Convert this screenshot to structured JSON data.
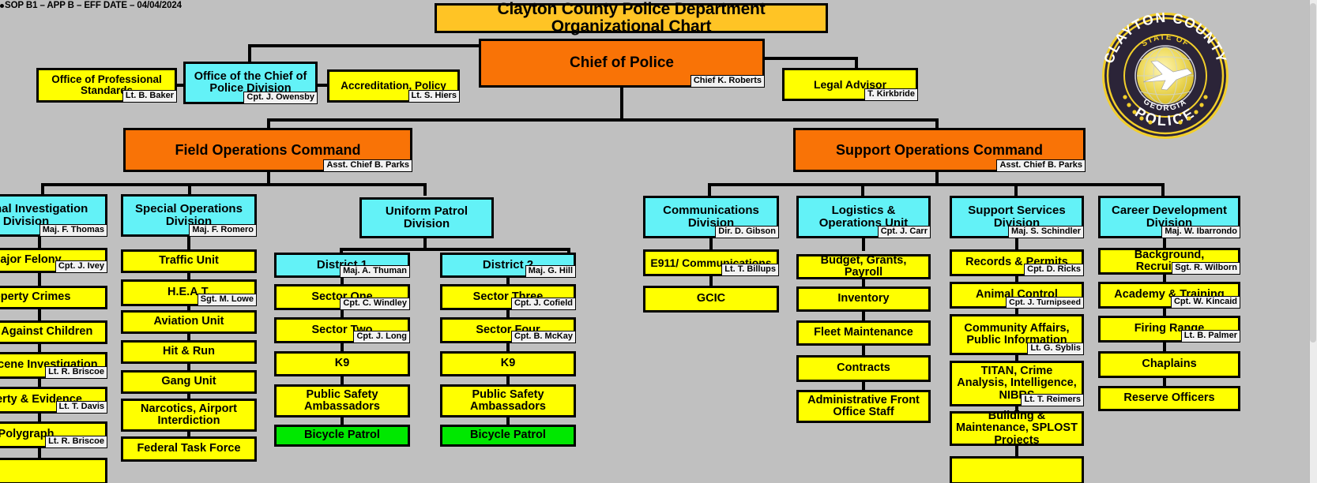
{
  "header": {
    "sop_note": "SOP B1 – APP B – EFF DATE – 04/04/2024",
    "title": "Clayton County Police Department Organizational Chart"
  },
  "seal": {
    "name": "clayton-county-police-seal",
    "outer_top_text": "CLAYTON COUNTY",
    "outer_bottom_text": "POLICE",
    "inner_top_text": "STATE OF",
    "inner_bottom_text": "GEORGIA",
    "colors": {
      "ring": "#2b2438",
      "gold": "#f2cf2b",
      "globe": "#efe06a"
    }
  },
  "colors": {
    "command": "#f97306",
    "division": "#63f2f7",
    "unit": "#ffff00",
    "highlight": "#00e800",
    "title": "#ffc425",
    "background": "#c0c0c0",
    "tag": "#f2f2f2"
  },
  "chief": {
    "label": "Chief of Police",
    "person": "Chief K. Roberts"
  },
  "chief_staff": [
    {
      "label": "Office of Professional Standards",
      "person": "Lt. B. Baker",
      "color": "unit"
    },
    {
      "label": "Office of the Chief of Police Division",
      "person": "Cpt. J. Owensby",
      "color": "division"
    },
    {
      "label": "Accreditation, Policy",
      "person": "Lt.  S. Hiers",
      "color": "unit"
    },
    {
      "label": "Legal Advisor",
      "person": "T. Kirkbride",
      "color": "unit"
    }
  ],
  "commands": [
    {
      "label": "Field Operations Command",
      "person": "Asst. Chief B. Parks"
    },
    {
      "label": "Support Operations  Command",
      "person": "Asst. Chief B. Parks"
    }
  ],
  "field_operations": {
    "divisions": [
      {
        "label": "Criminal Investigation Division",
        "person": "Maj. F. Thomas",
        "units": [
          {
            "label": "Major Felony",
            "person": "Cpt. J. Ivey"
          },
          {
            "label": "Property Crimes",
            "person": ""
          },
          {
            "label": "Crimes Against Children",
            "person": ""
          },
          {
            "label": "Crime Scene Investigation",
            "person": "Lt. R. Briscoe"
          },
          {
            "label": "Property & Evidence",
            "person": "Lt. T. Davis"
          },
          {
            "label": "Polygraph",
            "person": "Lt. R. Briscoe"
          }
        ]
      },
      {
        "label": "Special Operations Division",
        "person": "Maj. F. Romero",
        "units": [
          {
            "label": "Traffic Unit",
            "person": ""
          },
          {
            "label": "H.E.A.T.",
            "person": "Sgt. M. Lowe"
          },
          {
            "label": "Aviation Unit",
            "person": ""
          },
          {
            "label": "Hit & Run",
            "person": ""
          },
          {
            "label": "Gang Unit",
            "person": ""
          },
          {
            "label": "Narcotics, Airport Interdiction",
            "person": ""
          },
          {
            "label": "Federal Task Force",
            "person": ""
          }
        ]
      },
      {
        "label": "Uniform Patrol Division",
        "person": "",
        "districts": [
          {
            "label": "District 1",
            "person": "Maj. A. Thuman",
            "units": [
              {
                "label": "Sector One",
                "person": "Cpt. C. Windley",
                "color": "unit"
              },
              {
                "label": "Sector Two",
                "person": "Cpt. J. Long",
                "color": "unit"
              },
              {
                "label": "K9",
                "person": "",
                "color": "unit"
              },
              {
                "label": "Public Safety Ambassadors",
                "person": "",
                "color": "unit"
              },
              {
                "label": "Bicycle Patrol",
                "person": "",
                "color": "highlight"
              }
            ]
          },
          {
            "label": "District 2",
            "person": "Maj. G. Hill",
            "units": [
              {
                "label": "Sector Three",
                "person": "Cpt. J. Cofield",
                "color": "unit"
              },
              {
                "label": "Sector Four",
                "person": "Cpt. B. McKay",
                "color": "unit"
              },
              {
                "label": "K9",
                "person": "",
                "color": "unit"
              },
              {
                "label": "Public Safety Ambassadors",
                "person": "",
                "color": "unit"
              },
              {
                "label": "Bicycle Patrol",
                "person": "",
                "color": "highlight"
              }
            ]
          }
        ]
      }
    ]
  },
  "support_operations": {
    "divisions": [
      {
        "label": "Communications Division",
        "person": "Dir. D. Gibson",
        "units": [
          {
            "label": "E911/ Communications",
            "person": "Lt. T. Billups"
          },
          {
            "label": "GCIC",
            "person": ""
          }
        ]
      },
      {
        "label": "Logistics & Operations Unit",
        "person": "Cpt. J. Carr",
        "units": [
          {
            "label": "Budget, Grants, Payroll",
            "person": ""
          },
          {
            "label": "Inventory",
            "person": ""
          },
          {
            "label": "Fleet Maintenance",
            "person": ""
          },
          {
            "label": "Contracts",
            "person": ""
          },
          {
            "label": "Administrative Front Office Staff",
            "person": ""
          }
        ]
      },
      {
        "label": "Support Services Division",
        "person": "Maj. S. Schindler",
        "units": [
          {
            "label": "Records & Permits",
            "person": "Cpt. D. Ricks"
          },
          {
            "label": "Animal Control",
            "person": "Cpt. J. Turnipseed"
          },
          {
            "label": "Community Affairs, Public Information",
            "person": "Lt. G. Syblis"
          },
          {
            "label": "TITAN, Crime Analysis, Intelligence, NIBRS",
            "person": "Lt. T. Reimers"
          },
          {
            "label": "Building & Maintenance, SPLOST Projects",
            "person": ""
          }
        ]
      },
      {
        "label": "Career Development Division",
        "person": "Maj. W. Ibarrondo",
        "units": [
          {
            "label": "Background, Recruitment",
            "person": "Sgt. R. Wilborn"
          },
          {
            "label": "Academy & Training",
            "person": "Cpt. W. Kincaid"
          },
          {
            "label": "Firing Range",
            "person": "Lt. B. Palmer"
          },
          {
            "label": "Chaplains",
            "person": ""
          },
          {
            "label": "Reserve Officers",
            "person": ""
          }
        ]
      }
    ]
  }
}
